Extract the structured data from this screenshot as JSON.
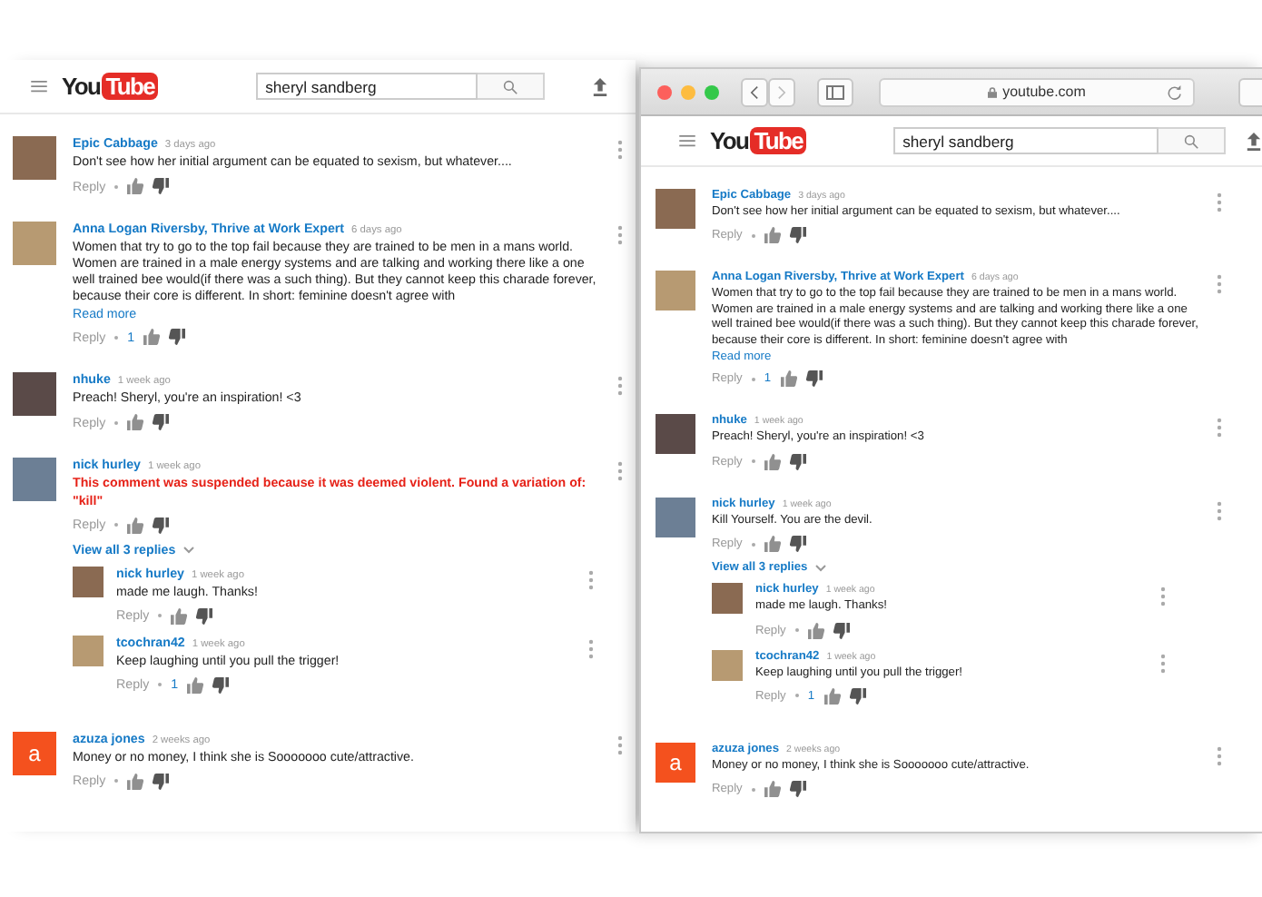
{
  "panels": [
    {
      "logo": [
        "You",
        "Tube"
      ],
      "search": {
        "value": "sheryl sandberg"
      },
      "comments": [
        {
          "author": "Epic Cabbage",
          "time": "3 days ago",
          "kind": "comment",
          "avatar": {
            "kind": "photo"
          },
          "text": "Don't see how her initial argument can be equated to sexism, but whatever....",
          "reply": "Reply"
        },
        {
          "author": "Anna Logan Riversby, Thrive at Work Expert",
          "time": "6 days ago",
          "kind": "comment",
          "avatar": {
            "kind": "photo"
          },
          "text": "Women that try to go to the top fail because they are trained to be men in a mans world. Women are trained in a male energy systems and are talking and working there like a one well trained bee would(if there was a such thing). But they cannot keep this charade forever, because their core is different. In short: feminine doesn't agree with",
          "read_more": "Read more",
          "reply": "Reply",
          "likes": "1"
        },
        {
          "author": "nhuke",
          "time": "1 week ago",
          "kind": "comment",
          "avatar": {
            "kind": "photo"
          },
          "text": "Preach! Sheryl, you're an inspiration! <3",
          "reply": "Reply"
        },
        {
          "author": "nick hurley",
          "time": "1 week ago",
          "kind": "suspended",
          "avatar": {
            "kind": "photo"
          },
          "text": "This comment was suspended because it was deemed violent. Found a variation of: \"kill\"",
          "reply": "Reply",
          "view_replies": "View all 3 replies",
          "replies": [
            {
              "author": "nick hurley",
              "time": "1 week ago",
              "kind": "comment",
              "avatar": {
                "kind": "photo"
              },
              "text": "made me laugh. Thanks!",
              "reply": "Reply"
            },
            {
              "author": "tcochran42",
              "time": "1 week ago",
              "kind": "comment",
              "avatar": {
                "kind": "photo"
              },
              "text": "Keep laughing until you pull the trigger!",
              "reply": "Reply",
              "likes": "1"
            }
          ]
        },
        {
          "author": "azuza jones",
          "time": "2 weeks ago",
          "kind": "comment",
          "avatar": {
            "kind": "letter",
            "letter": "a"
          },
          "text": "Money or no money, I think she is Sooooooo cute/attractive.",
          "reply": "Reply"
        }
      ]
    },
    {
      "window": {
        "url": "youtube.com"
      },
      "logo": [
        "You",
        "Tube"
      ],
      "search": {
        "value": "sheryl sandberg"
      },
      "comments": [
        {
          "author": "Epic Cabbage",
          "time": "3 days ago",
          "kind": "comment",
          "avatar": {
            "kind": "photo"
          },
          "text": "Don't see how her initial argument can be equated to sexism, but whatever....",
          "reply": "Reply"
        },
        {
          "author": "Anna Logan Riversby, Thrive at Work Expert",
          "time": "6 days ago",
          "kind": "comment",
          "avatar": {
            "kind": "photo"
          },
          "text": "Women that try to go to the top fail because they are trained to be men in a mans world. Women are trained in a male energy systems and are talking and working there like a one well trained bee would(if there was a such thing). But they cannot keep this charade forever, because their core is different. In short: feminine doesn't agree with",
          "read_more": "Read more",
          "reply": "Reply",
          "likes": "1"
        },
        {
          "author": "nhuke",
          "time": "1 week ago",
          "kind": "comment",
          "avatar": {
            "kind": "photo"
          },
          "text": "Preach! Sheryl, you're an inspiration! <3",
          "reply": "Reply"
        },
        {
          "author": "nick hurley",
          "time": "1 week ago",
          "kind": "comment",
          "avatar": {
            "kind": "photo"
          },
          "text": "Kill Yourself. You are the devil.",
          "reply": "Reply",
          "view_replies": "View all 3 replies",
          "replies": [
            {
              "author": "nick hurley",
              "time": "1 week ago",
              "kind": "comment",
              "avatar": {
                "kind": "photo"
              },
              "text": "made me laugh. Thanks!",
              "reply": "Reply"
            },
            {
              "author": "tcochran42",
              "time": "1 week ago",
              "kind": "comment",
              "avatar": {
                "kind": "photo"
              },
              "text": "Keep laughing until you pull the trigger!",
              "reply": "Reply",
              "likes": "1"
            }
          ]
        },
        {
          "author": "azuza jones",
          "time": "2 weeks ago",
          "kind": "comment",
          "avatar": {
            "kind": "letter",
            "letter": "a"
          },
          "text": "Money or no money, I think she is Sooooooo cute/attractive.",
          "reply": "Reply"
        }
      ]
    }
  ]
}
